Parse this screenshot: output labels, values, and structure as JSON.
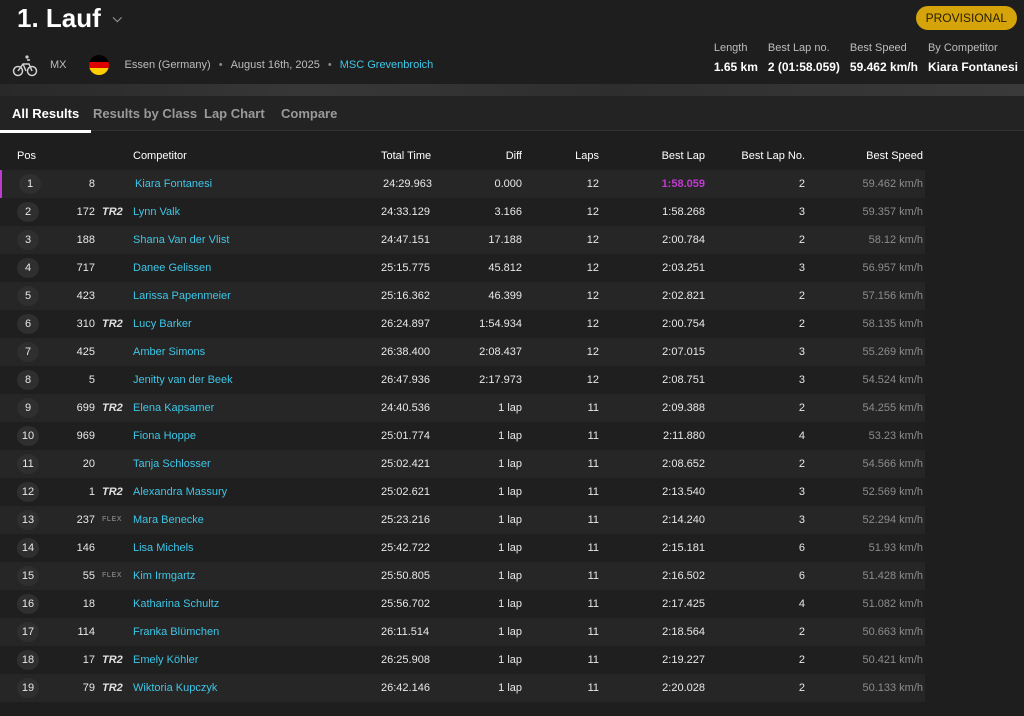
{
  "header": {
    "title": "1. Lauf",
    "status_badge": "PROVISIONAL",
    "class": "MX",
    "venue": "Essen (Germany)",
    "date": "August 16th, 2025",
    "club": "MSC Grevenbroich",
    "separator": "•"
  },
  "stats": {
    "length_label": "Length",
    "length_value": "1.65 km",
    "best_lap_no_label": "Best Lap no.",
    "best_lap_no_value": "2 (01:58.059)",
    "best_speed_label": "Best Speed",
    "best_speed_value": "59.462 km/h",
    "by_competitor_label": "By Competitor",
    "by_competitor_value": "Kiara Fontanesi"
  },
  "tabs": [
    "All Results",
    "Results by Class",
    "Lap Chart",
    "Compare"
  ],
  "columns": {
    "pos": "Pos",
    "competitor": "Competitor",
    "total_time": "Total Time",
    "diff": "Diff",
    "laps": "Laps",
    "best_lap": "Best Lap",
    "best_lap_no": "Best Lap No.",
    "best_speed": "Best Speed"
  },
  "logos": {
    "tr2": "TR2",
    "flex": "FLEX"
  },
  "colors": {
    "accent": "#3ec6e6",
    "badge": "#d4a40a",
    "best_lap_highlight": "#c03ad0"
  },
  "rows": [
    {
      "pos": "1",
      "num": "8",
      "logo": "",
      "name": "Kiara Fontanesi",
      "total": "24:29.963",
      "diff": "0.000",
      "laps": "12",
      "best": "1:58.059",
      "best_no": "2",
      "speed": "59.462 km/h"
    },
    {
      "pos": "2",
      "num": "172",
      "logo": "TR2",
      "name": "Lynn Valk",
      "total": "24:33.129",
      "diff": "3.166",
      "laps": "12",
      "best": "1:58.268",
      "best_no": "3",
      "speed": "59.357 km/h"
    },
    {
      "pos": "3",
      "num": "188",
      "logo": "",
      "name": "Shana Van der Vlist",
      "total": "24:47.151",
      "diff": "17.188",
      "laps": "12",
      "best": "2:00.784",
      "best_no": "2",
      "speed": "58.12 km/h"
    },
    {
      "pos": "4",
      "num": "717",
      "logo": "",
      "name": "Danee Gelissen",
      "total": "25:15.775",
      "diff": "45.812",
      "laps": "12",
      "best": "2:03.251",
      "best_no": "3",
      "speed": "56.957 km/h"
    },
    {
      "pos": "5",
      "num": "423",
      "logo": "",
      "name": "Larissa Papenmeier",
      "total": "25:16.362",
      "diff": "46.399",
      "laps": "12",
      "best": "2:02.821",
      "best_no": "2",
      "speed": "57.156 km/h"
    },
    {
      "pos": "6",
      "num": "310",
      "logo": "TR2",
      "name": "Lucy Barker",
      "total": "26:24.897",
      "diff": "1:54.934",
      "laps": "12",
      "best": "2:00.754",
      "best_no": "2",
      "speed": "58.135 km/h"
    },
    {
      "pos": "7",
      "num": "425",
      "logo": "",
      "name": "Amber Simons",
      "total": "26:38.400",
      "diff": "2:08.437",
      "laps": "12",
      "best": "2:07.015",
      "best_no": "3",
      "speed": "55.269 km/h"
    },
    {
      "pos": "8",
      "num": "5",
      "logo": "",
      "name": "Jenitty van der Beek",
      "total": "26:47.936",
      "diff": "2:17.973",
      "laps": "12",
      "best": "2:08.751",
      "best_no": "3",
      "speed": "54.524 km/h"
    },
    {
      "pos": "9",
      "num": "699",
      "logo": "TR2",
      "name": "Elena Kapsamer",
      "total": "24:40.536",
      "diff": "1 lap",
      "laps": "11",
      "best": "2:09.388",
      "best_no": "2",
      "speed": "54.255 km/h"
    },
    {
      "pos": "10",
      "num": "969",
      "logo": "",
      "name": "Fiona Hoppe",
      "total": "25:01.774",
      "diff": "1 lap",
      "laps": "11",
      "best": "2:11.880",
      "best_no": "4",
      "speed": "53.23 km/h"
    },
    {
      "pos": "11",
      "num": "20",
      "logo": "",
      "name": "Tanja Schlosser",
      "total": "25:02.421",
      "diff": "1 lap",
      "laps": "11",
      "best": "2:08.652",
      "best_no": "2",
      "speed": "54.566 km/h"
    },
    {
      "pos": "12",
      "num": "1",
      "logo": "TR2",
      "name": "Alexandra Massury",
      "total": "25:02.621",
      "diff": "1 lap",
      "laps": "11",
      "best": "2:13.540",
      "best_no": "3",
      "speed": "52.569 km/h"
    },
    {
      "pos": "13",
      "num": "237",
      "logo": "FLEX",
      "name": "Mara Benecke",
      "total": "25:23.216",
      "diff": "1 lap",
      "laps": "11",
      "best": "2:14.240",
      "best_no": "3",
      "speed": "52.294 km/h"
    },
    {
      "pos": "14",
      "num": "146",
      "logo": "",
      "name": "Lisa Michels",
      "total": "25:42.722",
      "diff": "1 lap",
      "laps": "11",
      "best": "2:15.181",
      "best_no": "6",
      "speed": "51.93 km/h"
    },
    {
      "pos": "15",
      "num": "55",
      "logo": "FLEX",
      "name": "Kim Irmgartz",
      "total": "25:50.805",
      "diff": "1 lap",
      "laps": "11",
      "best": "2:16.502",
      "best_no": "6",
      "speed": "51.428 km/h"
    },
    {
      "pos": "16",
      "num": "18",
      "logo": "",
      "name": "Katharina Schultz",
      "total": "25:56.702",
      "diff": "1 lap",
      "laps": "11",
      "best": "2:17.425",
      "best_no": "4",
      "speed": "51.082 km/h"
    },
    {
      "pos": "17",
      "num": "114",
      "logo": "",
      "name": "Franka Blümchen",
      "total": "26:11.514",
      "diff": "1 lap",
      "laps": "11",
      "best": "2:18.564",
      "best_no": "2",
      "speed": "50.663 km/h"
    },
    {
      "pos": "18",
      "num": "17",
      "logo": "TR2",
      "name": "Emely Köhler",
      "total": "26:25.908",
      "diff": "1 lap",
      "laps": "11",
      "best": "2:19.227",
      "best_no": "2",
      "speed": "50.421 km/h"
    },
    {
      "pos": "19",
      "num": "79",
      "logo": "TR2",
      "name": "Wiktoria Kupczyk",
      "total": "26:42.146",
      "diff": "1 lap",
      "laps": "11",
      "best": "2:20.028",
      "best_no": "2",
      "speed": "50.133 km/h"
    }
  ]
}
